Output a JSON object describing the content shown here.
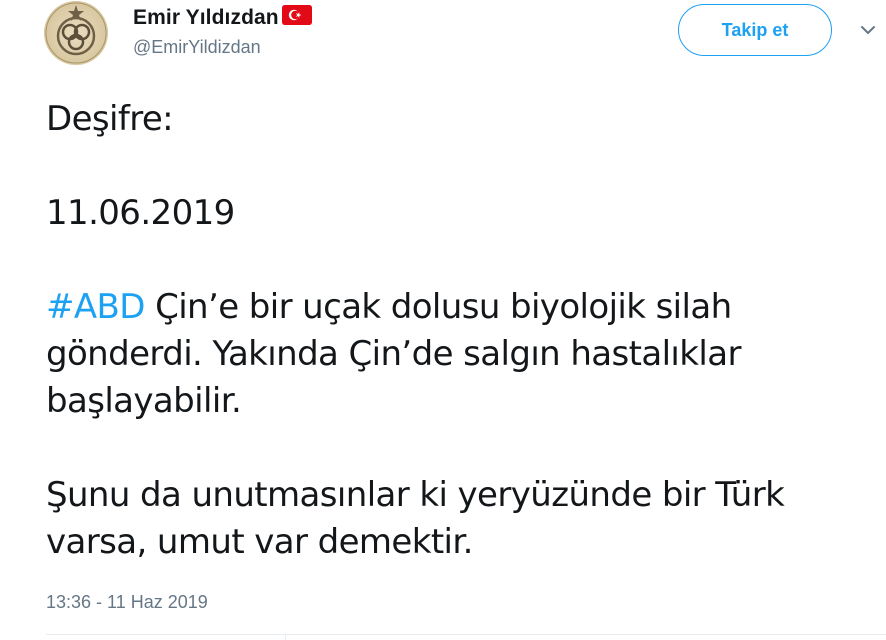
{
  "user": {
    "display_name": "Emir Yıldızdan",
    "handle": "@EmirYildizdan",
    "flag_icon": "turkey-flag-icon",
    "avatar_icon": "emblem-avatar-icon"
  },
  "follow_button": {
    "label": "Takip et"
  },
  "menu": {
    "icon": "chevron-down-icon"
  },
  "tweet": {
    "line1": "Deşifre:",
    "line2": "11.06.2019",
    "hashtag": "#ABD",
    "line3_rest": " Çin’e bir uçak dolusu biyolojik silah",
    "line4": "gönderdi. Yakında Çin’de salgın hastalıklar",
    "line5": "başlayabilir.",
    "line6": "Şunu da unutmasınlar ki yeryüzünde bir Türk",
    "line7": "varsa, umut var demektir."
  },
  "timestamp": "13:36 - 11 Haz 2019",
  "colors": {
    "accent": "#1da1f2",
    "text": "#14171a",
    "secondary": "#657786",
    "flag_red": "#e30a17"
  }
}
